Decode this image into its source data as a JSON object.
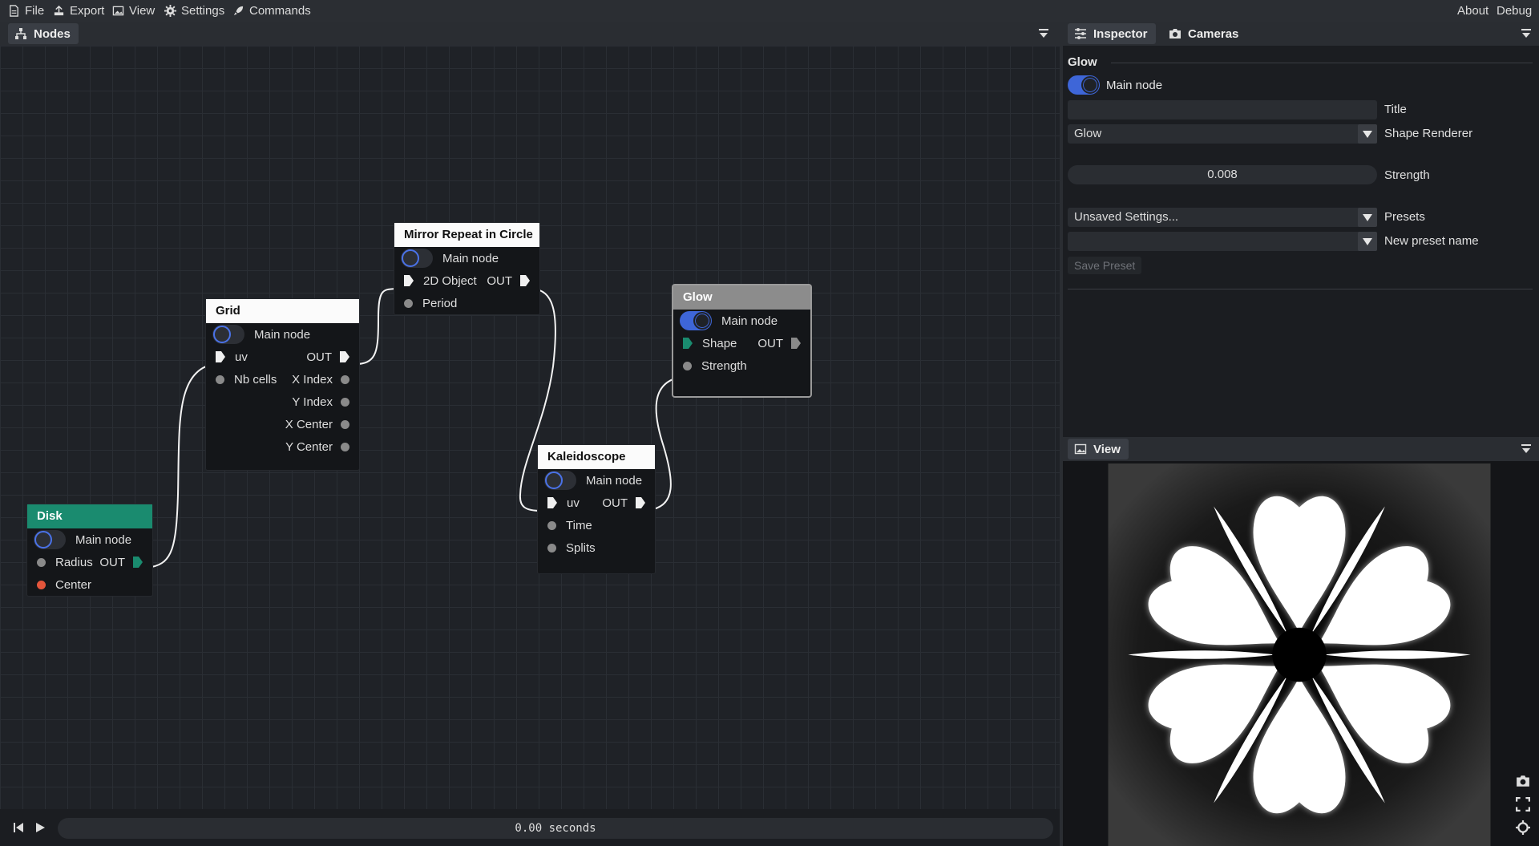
{
  "menu": {
    "file": "File",
    "export": "Export",
    "view": "View",
    "settings": "Settings",
    "commands": "Commands",
    "about": "About",
    "debug": "Debug"
  },
  "nodes_panel": {
    "tab_label": "Nodes"
  },
  "nodes": {
    "mirror": {
      "title": "Mirror Repeat in Circle",
      "main": "Main node",
      "in1": "2D Object",
      "out": "OUT",
      "in2": "Period"
    },
    "grid": {
      "title": "Grid",
      "main": "Main node",
      "in1": "uv",
      "out": "OUT",
      "in2": "Nb cells",
      "o2": "X Index",
      "o3": "Y Index",
      "o4": "X Center",
      "o5": "Y Center"
    },
    "glow": {
      "title": "Glow",
      "main": "Main node",
      "in1": "Shape",
      "out": "OUT",
      "in2": "Strength"
    },
    "kaleido": {
      "title": "Kaleidoscope",
      "main": "Main node",
      "in1": "uv",
      "out": "OUT",
      "in2": "Time",
      "in3": "Splits"
    },
    "disk": {
      "title": "Disk",
      "main": "Main node",
      "in1": "Radius",
      "out": "OUT",
      "in2": "Center"
    }
  },
  "inspector": {
    "tab_inspector": "Inspector",
    "tab_cameras": "Cameras",
    "section_title": "Glow",
    "main_node_label": "Main node",
    "title_value": "",
    "title_label": "Title",
    "renderer_value": "Glow",
    "renderer_label": "Shape Renderer",
    "strength_value": "0.008",
    "strength_label": "Strength",
    "presets_value": "Unsaved Settings...",
    "presets_label": "Presets",
    "new_preset_value": "",
    "new_preset_label": "New preset name",
    "save_preset": "Save Preset"
  },
  "view_panel": {
    "tab_label": "View"
  },
  "timeline": {
    "time": "0.00 seconds"
  },
  "colors": {
    "accent": "#3e66d8",
    "teal": "#1a8b6f",
    "red": "#e4553b"
  }
}
